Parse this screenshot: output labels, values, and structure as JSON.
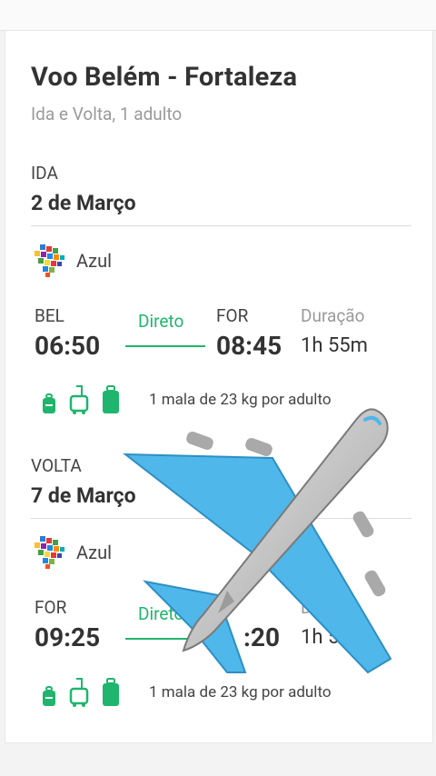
{
  "flight": {
    "title": "Voo Belém - Fortaleza",
    "subtitle": "Ida e Volta, 1 adulto"
  },
  "segments": [
    {
      "label": "IDA",
      "date": "2 de Março",
      "airline": "Azul",
      "origin_code": "BEL",
      "origin_time": "06:50",
      "stops": "Direto",
      "destination_code": "FOR",
      "destination_time": "08:45",
      "duration_label": "Duração",
      "duration": "1h 55m",
      "baggage": "1 mala de 23 kg por adulto"
    },
    {
      "label": "VOLTA",
      "date": "7 de Março",
      "airline": "Azul",
      "origin_code": "FOR",
      "origin_time": "09:25",
      "stops": "Direto",
      "destination_code": "",
      "destination_time": ":20",
      "duration_label": "Dur",
      "duration": "1h 55",
      "baggage": "1 mala de 23 kg por adulto"
    }
  ],
  "icons": {
    "airline_logo": "azul-logo-icon",
    "small_bag": "backpack-icon",
    "medium_bag": "carry-on-icon",
    "large_bag": "suitcase-icon",
    "overlay": "airplane-emoji-icon"
  },
  "colors": {
    "accent_green": "#1fb56d",
    "text_dark": "#333333",
    "text_muted": "#9a9a9a",
    "plane_blue": "#4fb7ea"
  }
}
